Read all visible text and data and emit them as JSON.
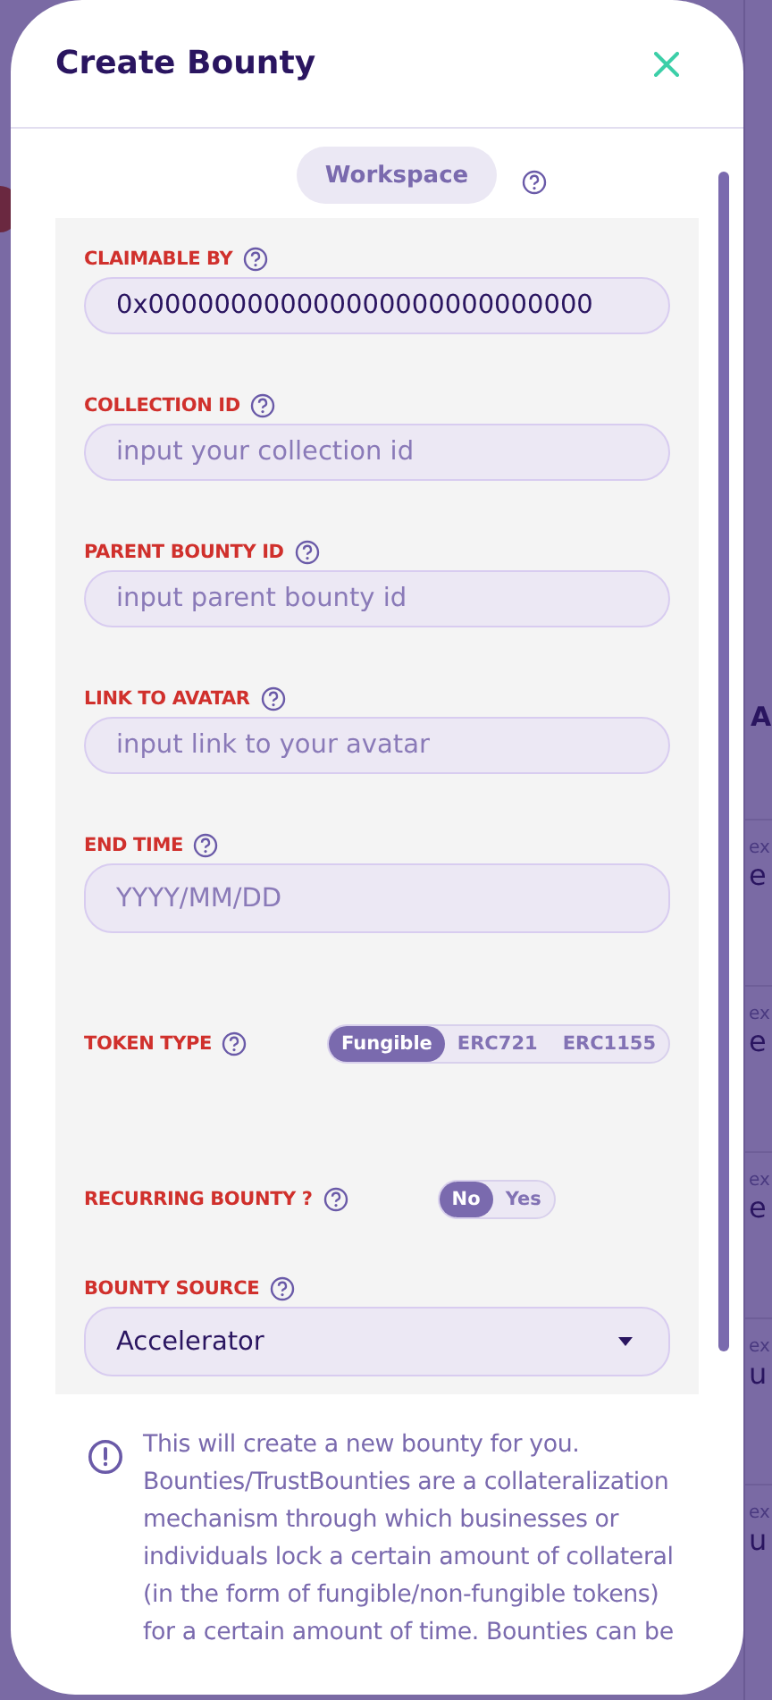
{
  "backdrop": {
    "right_header": "A",
    "right_rows": [
      {
        "label": "ex",
        "value": "e"
      },
      {
        "label": "ex",
        "value": "e"
      },
      {
        "label": "ex",
        "value": "e"
      },
      {
        "label": "ex",
        "value": "u"
      },
      {
        "label": "ex",
        "value": "u"
      }
    ]
  },
  "dialog": {
    "title": "Create Bounty"
  },
  "workspace": {
    "label": "Workspace"
  },
  "fields": [
    {
      "kind": "text",
      "label": "CLAIMABLE BY",
      "value": "0x000000000000000000000000000"
    },
    {
      "kind": "text",
      "label": "COLLECTION ID",
      "placeholder": "input your collection id"
    },
    {
      "kind": "text",
      "label": "PARENT BOUNTY ID",
      "placeholder": "input parent bounty id"
    },
    {
      "kind": "text",
      "label": "LINK TO AVATAR",
      "placeholder": "input link to your avatar"
    },
    {
      "kind": "date",
      "label": "END TIME",
      "placeholder": "YYYY/MM/DD"
    },
    {
      "kind": "segmented",
      "label": "TOKEN TYPE",
      "options": [
        {
          "label": "Fungible",
          "selected": true
        },
        {
          "label": "ERC721",
          "selected": false
        },
        {
          "label": "ERC1155",
          "selected": false
        }
      ]
    },
    {
      "kind": "toggle",
      "label": "RECURRING BOUNTY ?",
      "options": [
        {
          "label": "No",
          "selected": true
        },
        {
          "label": "Yes",
          "selected": false
        }
      ]
    },
    {
      "kind": "select",
      "label": "BOUNTY SOURCE",
      "value": "Accelerator"
    }
  ],
  "info": "This will create a new bounty for you. Bounties/TrustBounties are a collateralization mechanism through which businesses or individuals lock a certain amount of collateral (in the form of fungible/non-fungible tokens) for a certain amount of time. Bounties can be"
}
